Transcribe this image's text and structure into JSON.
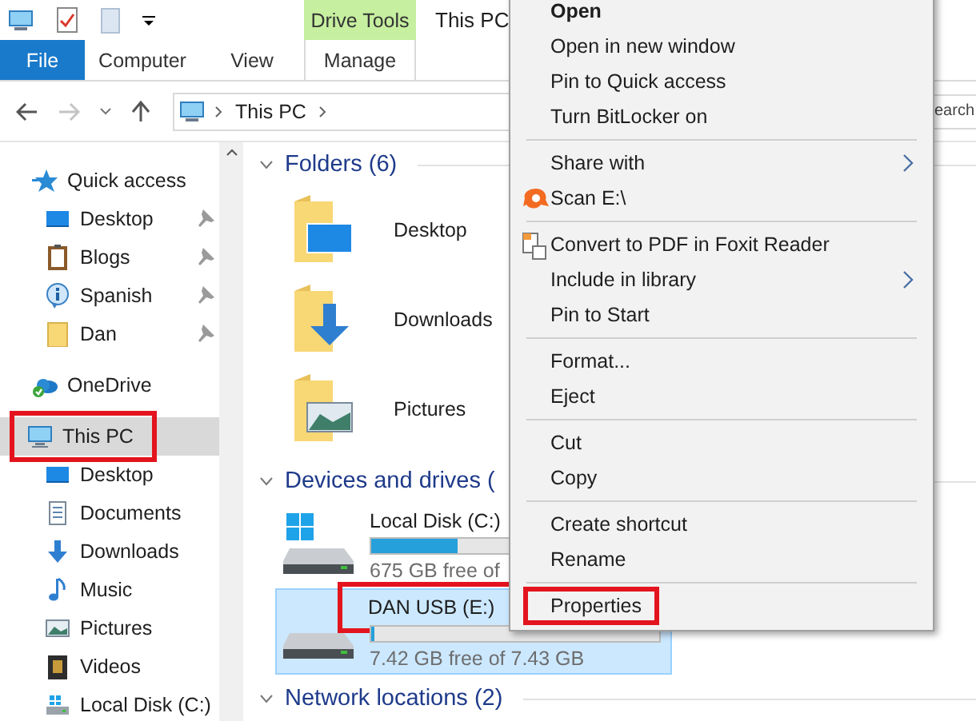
{
  "title_bar": {
    "title": "This PC",
    "contextual_group": "Drive Tools"
  },
  "ribbon_tabs": [
    {
      "label": "File",
      "kind": "file"
    },
    {
      "label": "Computer",
      "kind": "plain"
    },
    {
      "label": "View",
      "kind": "plain"
    },
    {
      "label": "Manage",
      "kind": "contextual"
    }
  ],
  "address_bar": {
    "path": [
      "This PC"
    ],
    "search_placeholder": "earch"
  },
  "navigation": [
    {
      "label": "Quick access",
      "kind": "star",
      "selected": false,
      "highlighted": false,
      "children": [
        {
          "label": "Desktop",
          "kind": "desktop",
          "pinned": true
        },
        {
          "label": "Blogs",
          "kind": "clipboard",
          "pinned": true
        },
        {
          "label": "Spanish",
          "kind": "info",
          "pinned": true
        },
        {
          "label": "Dan",
          "kind": "folder",
          "pinned": true
        }
      ]
    },
    {
      "label": "OneDrive",
      "kind": "cloud",
      "selected": false,
      "highlighted": false
    },
    {
      "label": "This PC",
      "kind": "pc",
      "selected": true,
      "highlighted": true,
      "children": [
        {
          "label": "Desktop",
          "kind": "desktop",
          "pinned": false
        },
        {
          "label": "Documents",
          "kind": "documents",
          "pinned": false
        },
        {
          "label": "Downloads",
          "kind": "download",
          "pinned": false
        },
        {
          "label": "Music",
          "kind": "music",
          "pinned": false
        },
        {
          "label": "Pictures",
          "kind": "pictures",
          "pinned": false
        },
        {
          "label": "Videos",
          "kind": "videos",
          "pinned": false
        },
        {
          "label": "Local Disk (C:)",
          "kind": "disk",
          "pinned": false
        }
      ]
    }
  ],
  "sections": [
    {
      "title": "Folders (6)",
      "kind": "folders",
      "items": [
        {
          "name": "Desktop",
          "kind": "desktop"
        },
        {
          "name": "Downloads",
          "kind": "download"
        },
        {
          "name": "Pictures",
          "kind": "pictures"
        }
      ]
    },
    {
      "title": "Devices and drives (",
      "kind": "drives",
      "items": [
        {
          "name": "Local Disk (C:)",
          "kind": "windows-disk",
          "level": 0.3,
          "free": "675 GB free of",
          "selected": false,
          "highlighted": false
        },
        {
          "name": "DAN USB (E:)",
          "kind": "usb",
          "level": 0.01,
          "free": "7.42 GB free of 7.43 GB",
          "selected": true,
          "highlighted": true
        }
      ]
    },
    {
      "title": "Network locations (2)",
      "kind": "network"
    }
  ],
  "context_menu": {
    "groups": [
      [
        {
          "label": "Open",
          "kind": "plain",
          "bold": true,
          "submenu": false,
          "highlighted": false
        },
        {
          "label": "Open in new window",
          "kind": "plain",
          "bold": false,
          "submenu": false,
          "highlighted": false
        },
        {
          "label": "Pin to Quick access",
          "kind": "plain",
          "bold": false,
          "submenu": false,
          "highlighted": false
        },
        {
          "label": "Turn BitLocker on",
          "kind": "plain",
          "bold": false,
          "submenu": false,
          "highlighted": false
        }
      ],
      [
        {
          "label": "Share with",
          "kind": "plain",
          "bold": false,
          "submenu": true,
          "highlighted": false
        },
        {
          "label": "Scan E:\\",
          "kind": "scan",
          "bold": false,
          "submenu": false,
          "highlighted": false
        }
      ],
      [
        {
          "label": "Convert to PDF in Foxit Reader",
          "kind": "convert",
          "bold": false,
          "submenu": false,
          "highlighted": false
        },
        {
          "label": "Include in library",
          "kind": "plain",
          "bold": false,
          "submenu": true,
          "highlighted": false
        },
        {
          "label": "Pin to Start",
          "kind": "plain",
          "bold": false,
          "submenu": false,
          "highlighted": false
        }
      ],
      [
        {
          "label": "Format...",
          "kind": "plain",
          "bold": false,
          "submenu": false,
          "highlighted": false
        },
        {
          "label": "Eject",
          "kind": "plain",
          "bold": false,
          "submenu": false,
          "highlighted": false
        }
      ],
      [
        {
          "label": "Cut",
          "kind": "plain",
          "bold": false,
          "submenu": false,
          "highlighted": false
        },
        {
          "label": "Copy",
          "kind": "plain",
          "bold": false,
          "submenu": false,
          "highlighted": false
        }
      ],
      [
        {
          "label": "Create shortcut",
          "kind": "plain",
          "bold": false,
          "submenu": false,
          "highlighted": false
        },
        {
          "label": "Rename",
          "kind": "plain",
          "bold": false,
          "submenu": false,
          "highlighted": false
        }
      ],
      [
        {
          "label": "Properties",
          "kind": "plain",
          "bold": false,
          "submenu": false,
          "highlighted": true
        }
      ]
    ]
  }
}
